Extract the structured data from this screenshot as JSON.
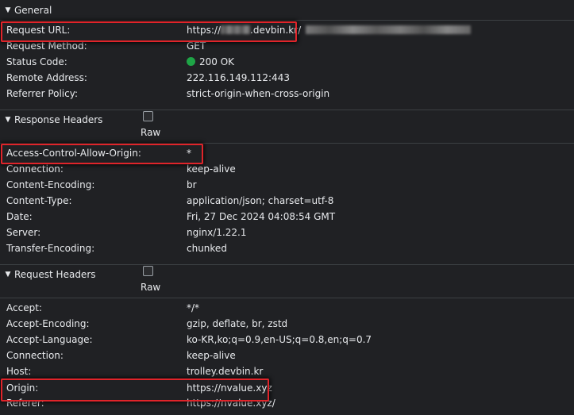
{
  "general": {
    "title": "General",
    "rows": [
      {
        "key": "Request URL:",
        "value_prefix": "https://",
        "value_mid": ".devbin.kr/"
      },
      {
        "key": "Request Method:",
        "value": "GET"
      },
      {
        "key": "Status Code:",
        "value": "200 OK"
      },
      {
        "key": "Remote Address:",
        "value": "222.116.149.112:443"
      },
      {
        "key": "Referrer Policy:",
        "value": "strict-origin-when-cross-origin"
      }
    ]
  },
  "response_headers": {
    "title": "Response Headers",
    "raw_label": "Raw",
    "rows": [
      {
        "key": "Access-Control-Allow-Origin:",
        "value": "*"
      },
      {
        "key": "Connection:",
        "value": "keep-alive"
      },
      {
        "key": "Content-Encoding:",
        "value": "br"
      },
      {
        "key": "Content-Type:",
        "value": "application/json; charset=utf-8"
      },
      {
        "key": "Date:",
        "value": "Fri, 27 Dec 2024 04:08:54 GMT"
      },
      {
        "key": "Server:",
        "value": "nginx/1.22.1"
      },
      {
        "key": "Transfer-Encoding:",
        "value": "chunked"
      }
    ]
  },
  "request_headers": {
    "title": "Request Headers",
    "raw_label": "Raw",
    "rows": [
      {
        "key": "Accept:",
        "value": "*/*"
      },
      {
        "key": "Accept-Encoding:",
        "value": "gzip, deflate, br, zstd"
      },
      {
        "key": "Accept-Language:",
        "value": "ko-KR,ko;q=0.9,en-US;q=0.8,en;q=0.7"
      },
      {
        "key": "Connection:",
        "value": "keep-alive"
      },
      {
        "key": "Host:",
        "value": "trolley.devbin.kr"
      },
      {
        "key": "Origin:",
        "value": "https://nvalue.xyz"
      },
      {
        "key": "Referer:",
        "value": "https://nvalue.xyz/"
      }
    ]
  },
  "colors": {
    "background": "#202124",
    "highlight": "#e0242a",
    "status_ok": "#1ea446"
  },
  "icons": {
    "expand": "triangle-down-icon",
    "status": "green-dot-icon"
  }
}
